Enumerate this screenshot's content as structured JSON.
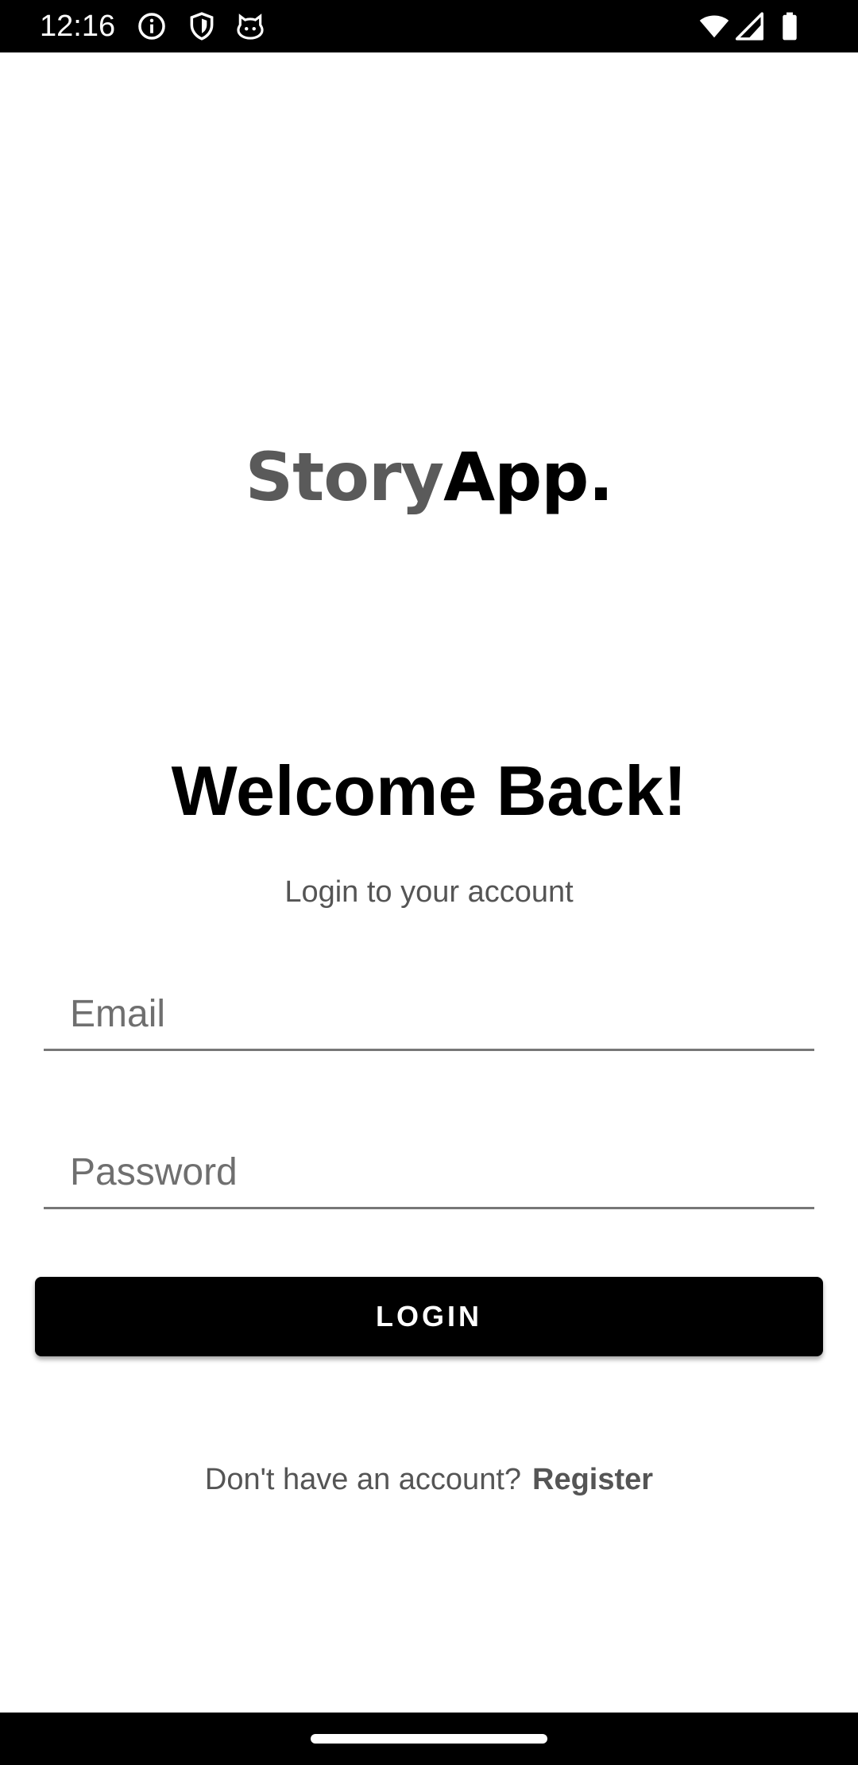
{
  "status_bar": {
    "time": "12:16",
    "icons": [
      "info-icon",
      "shield-icon",
      "cat-icon",
      "wifi-icon",
      "cellular-signal-icon",
      "battery-icon"
    ]
  },
  "logo": {
    "part1": "Story",
    "part2": "App."
  },
  "welcome": {
    "title": "Welcome Back!",
    "subtitle": "Login to your account"
  },
  "form": {
    "email_placeholder": "Email",
    "email_value": "",
    "password_placeholder": "Password",
    "password_value": "",
    "login_label": "LOGIN"
  },
  "register": {
    "prompt": "Don't have an account?",
    "link_label": "Register"
  },
  "colors": {
    "primary": "#000000",
    "logo_gray": "#5a5a5a",
    "secondary_text": "#555555",
    "background": "#ffffff"
  }
}
